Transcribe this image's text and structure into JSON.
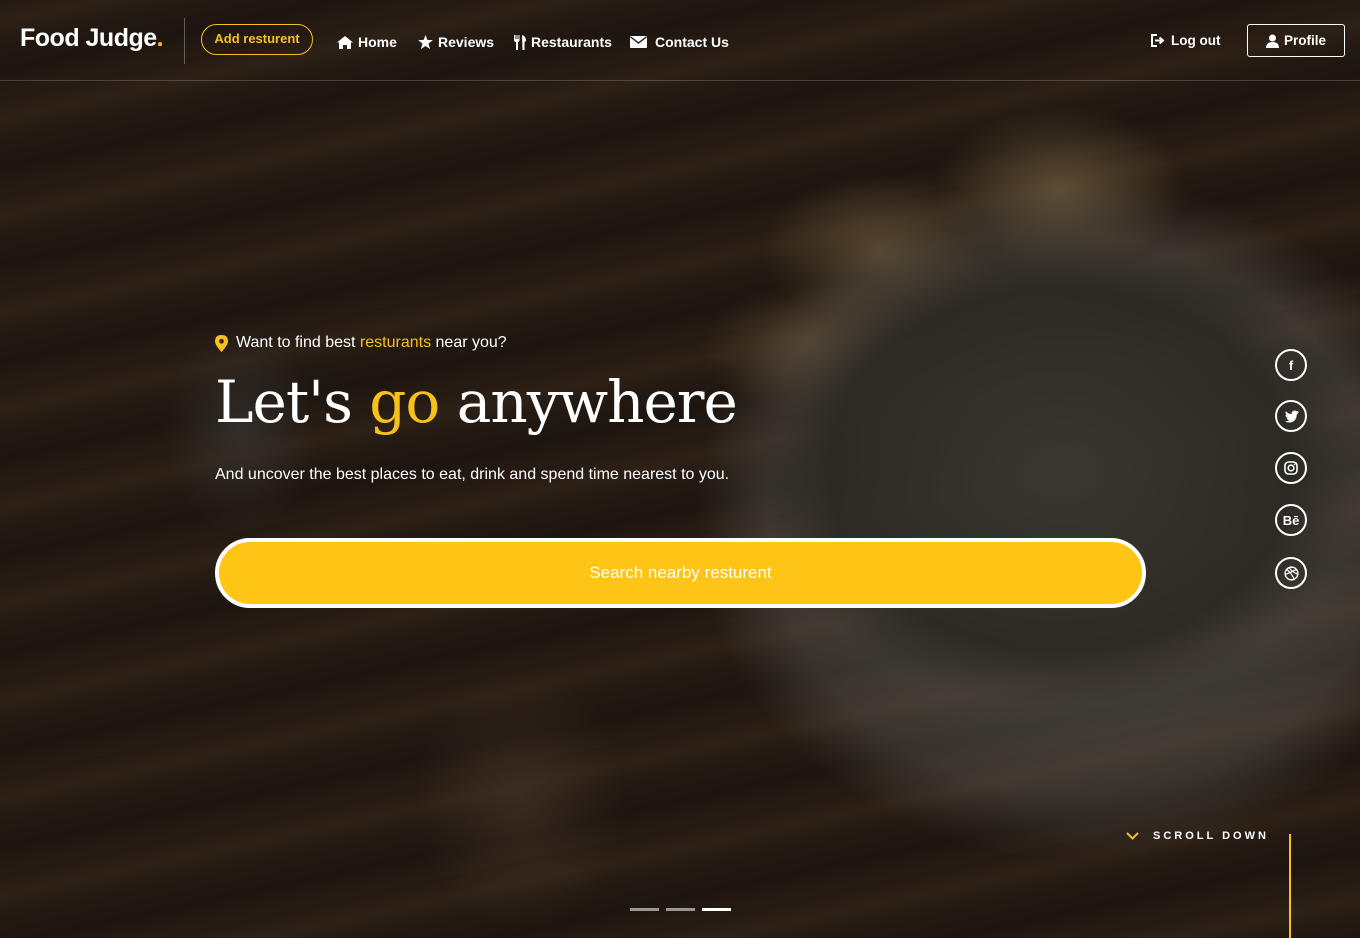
{
  "nav": {
    "logo_text": "Food Judge",
    "logo_dot": ".",
    "add_button": "Add resturent",
    "links": [
      {
        "label": "Home",
        "icon": "home-icon"
      },
      {
        "label": "Reviews",
        "icon": "star-icon"
      },
      {
        "label": "Restaurants",
        "icon": "cutlery-icon"
      },
      {
        "label": "Contact Us",
        "icon": "envelope-icon"
      }
    ],
    "logout": "Log out",
    "profile": "Profile"
  },
  "hero": {
    "tagline_pre": "Want to find best",
    "tagline_highlight": "resturants",
    "tagline_post": "near you?",
    "title_pre": "Let's",
    "title_highlight": "go",
    "title_post": "anywhere",
    "subtitle": "And uncover the best places to eat, drink and spend time nearest to you.",
    "search_button": "Search nearby resturent"
  },
  "social": [
    {
      "name": "facebook-icon",
      "glyph": "f"
    },
    {
      "name": "twitter-icon",
      "glyph": ""
    },
    {
      "name": "instagram-icon",
      "glyph": ""
    },
    {
      "name": "behance-icon",
      "glyph": "Bē"
    },
    {
      "name": "dribbble-icon",
      "glyph": ""
    }
  ],
  "scroll_down": "SCROLL DOWN",
  "slider": {
    "count": 3,
    "active_index": 2
  },
  "colors": {
    "accent": "#f7c01c",
    "button": "#fec416"
  }
}
